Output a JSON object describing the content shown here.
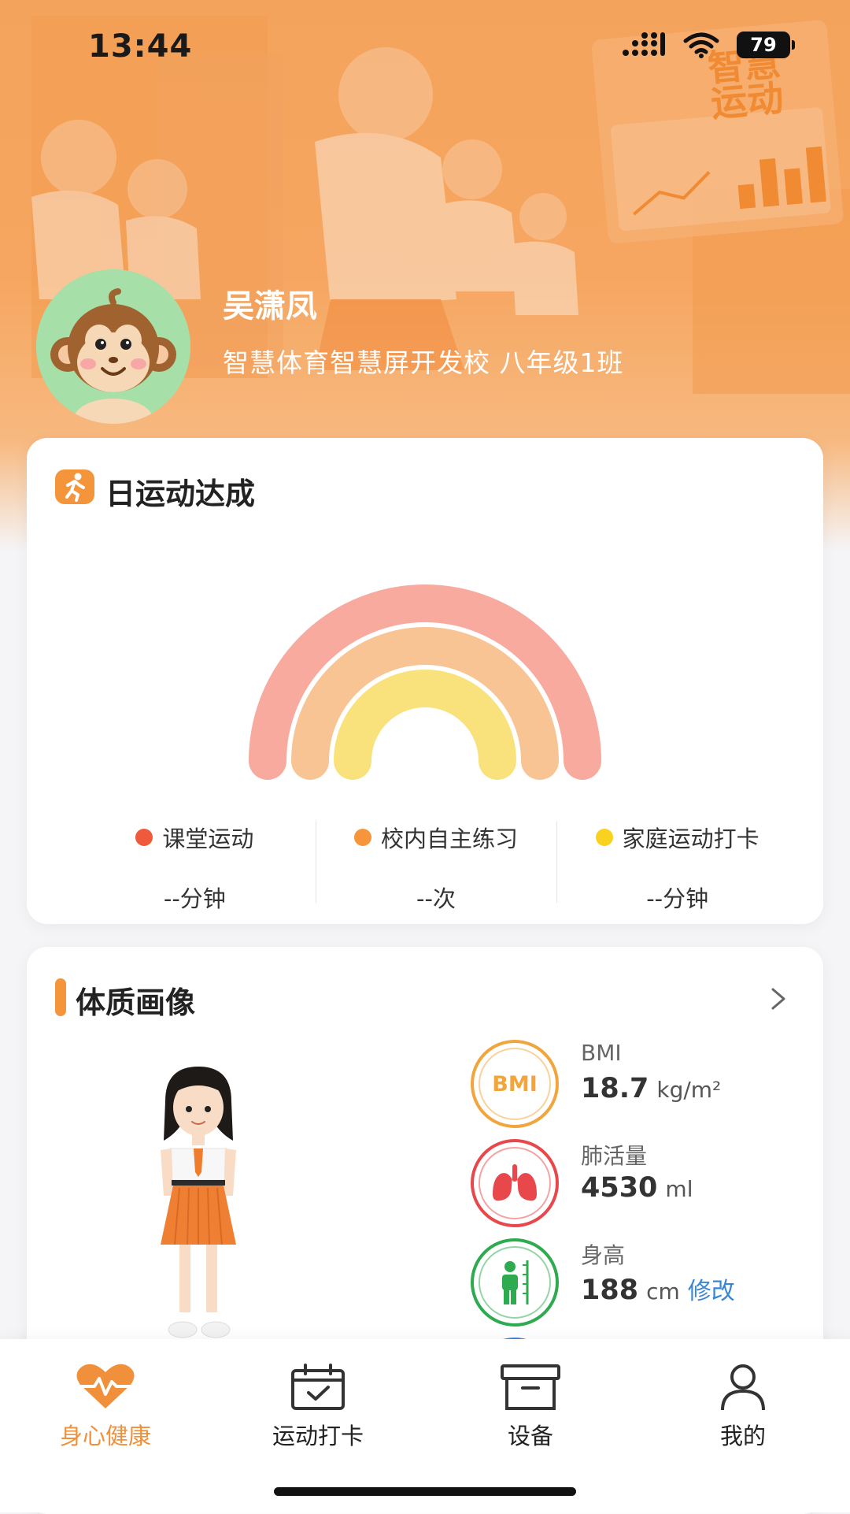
{
  "status_bar": {
    "time": "13:44",
    "battery": "79"
  },
  "banner": {
    "board_text_line1": "智慧",
    "board_text_line2": "运动"
  },
  "profile": {
    "name": "吴潇凤",
    "school_class": "智慧体育智慧屏开发校 八年级1班"
  },
  "daily_activity": {
    "title": "日运动达成",
    "stats": [
      {
        "label": "课堂运动",
        "value": "--分钟",
        "color": "#f05a3c"
      },
      {
        "label": "校内自主练习",
        "value": "--次",
        "color": "#f6953a"
      },
      {
        "label": "家庭运动打卡",
        "value": "--分钟",
        "color": "#f8d21e"
      }
    ],
    "ring_colors": [
      "#f8aa9e",
      "#f9c493",
      "#f9e27c"
    ]
  },
  "body_profile": {
    "title": "体质画像",
    "metrics": [
      {
        "label": "BMI",
        "icon_text": "BMI",
        "value": "18.7",
        "unit": "kg/m²",
        "color": "#f1a53c"
      },
      {
        "label": "肺活量",
        "value": "4530",
        "unit": "ml",
        "color": "#e8484b"
      },
      {
        "label": "身高",
        "value": "188",
        "unit": "cm",
        "edit": "修改",
        "color": "#2eaa4f"
      }
    ]
  },
  "tabbar": {
    "items": [
      {
        "label": "身心健康",
        "icon": "heart-pulse-icon",
        "active": true
      },
      {
        "label": "运动打卡",
        "icon": "calendar-check-icon",
        "active": false
      },
      {
        "label": "设备",
        "icon": "device-box-icon",
        "active": false
      },
      {
        "label": "我的",
        "icon": "user-icon",
        "active": false
      }
    ],
    "active_color": "#f0903a"
  }
}
